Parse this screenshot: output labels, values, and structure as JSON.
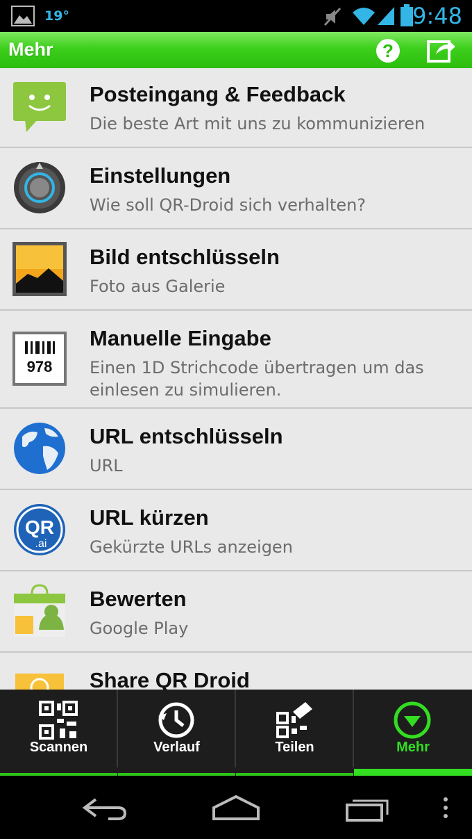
{
  "status": {
    "temperature": "19°",
    "time": "9:48"
  },
  "actionbar": {
    "title": "Mehr"
  },
  "items": [
    {
      "title": "Posteingang & Feedback",
      "subtitle": "Die beste Art mit uns zu kommunizieren"
    },
    {
      "title": "Einstellungen",
      "subtitle": "Wie soll QR-Droid sich verhalten?"
    },
    {
      "title": "Bild entschlüsseln",
      "subtitle": "Foto aus Galerie"
    },
    {
      "title": "Manuelle Eingabe",
      "subtitle": "Einen 1D Strichcode übertragen um das einlesen zu simulieren.",
      "icon_text": "978"
    },
    {
      "title": "URL entschlüsseln",
      "subtitle": "URL"
    },
    {
      "title": "URL kürzen",
      "subtitle": "Gekürzte URLs anzeigen",
      "icon_text_top": "QR",
      "icon_text_bottom": ".ai"
    },
    {
      "title": "Bewerten",
      "subtitle": "Google Play"
    },
    {
      "title": "Share QR Droid",
      "subtitle": ""
    }
  ],
  "tabs": [
    {
      "label": "Scannen"
    },
    {
      "label": "Verlauf"
    },
    {
      "label": "Teilen"
    },
    {
      "label": "Mehr"
    }
  ],
  "colors": {
    "accent": "#33dd22",
    "status_blue": "#33b5e5",
    "list_bg": "#e9e9e9"
  }
}
